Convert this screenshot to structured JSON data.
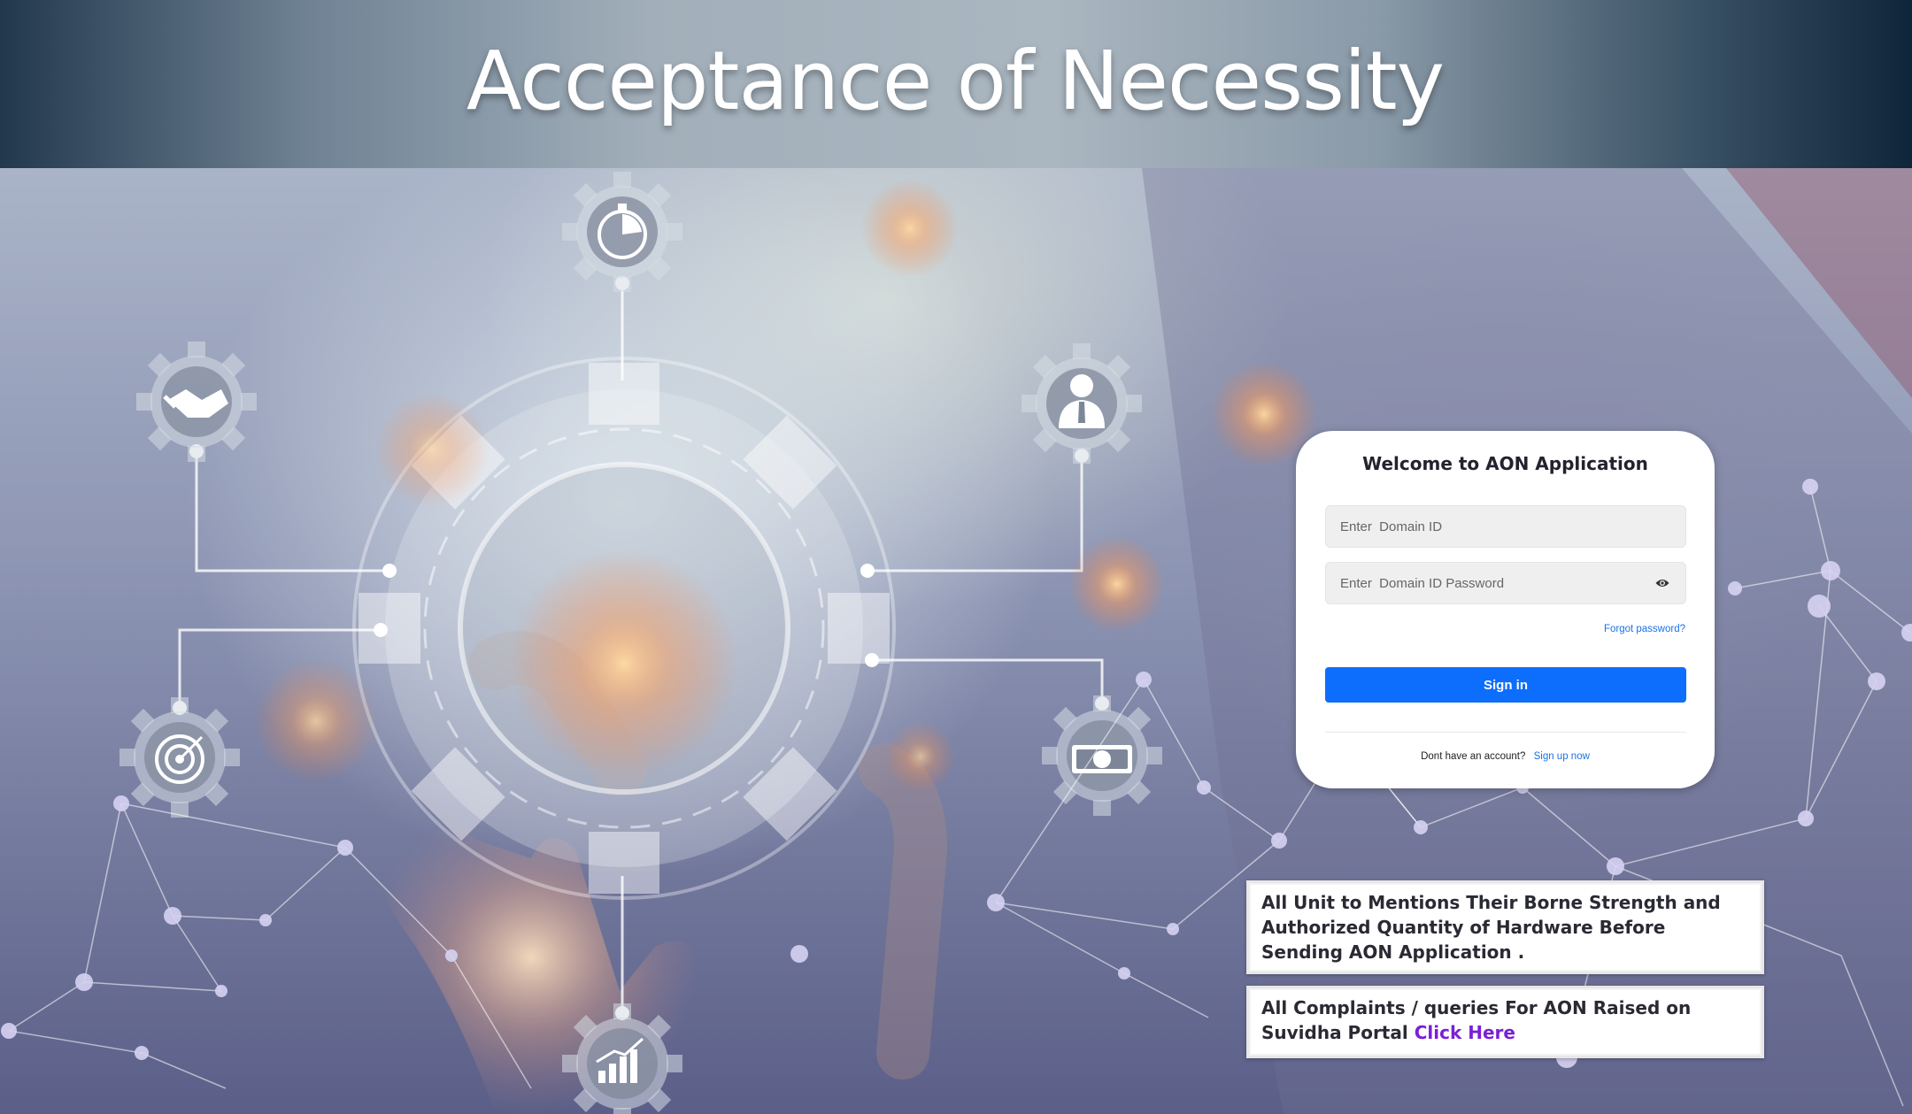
{
  "header": {
    "title": "Acceptance of Necessity"
  },
  "login": {
    "title": "Welcome to AON Application",
    "domain_id_placeholder": "Enter  Domain ID",
    "password_placeholder": "Enter  Domain ID Password",
    "forgot_password": "Forgot password?",
    "sign_in": "Sign in",
    "no_account_text": "Dont have an account?",
    "sign_up_link": "Sign up now"
  },
  "notices": {
    "unit_strength": "All Unit to Mentions Their Borne Strength and Authorized Quantity of Hardware Before Sending AON Application .",
    "complaints_text": "All Complaints / queries For AON Raised on Suvidha Portal",
    "click_here": "Click  Here"
  },
  "icons": {
    "top_gear": "stopwatch-icon",
    "left_gear": "handshake-icon",
    "right_gear": "businessman-icon",
    "lower_left_gear": "target-icon",
    "lower_right_gear": "money-icon",
    "bottom_gear": "growth-chart-icon",
    "password_toggle": "eye-icon"
  },
  "colors": {
    "primary_button": "#0d6efd",
    "link": "#1a73e8",
    "click_here": "#7a1fd6",
    "title_text": "#ffffff"
  }
}
